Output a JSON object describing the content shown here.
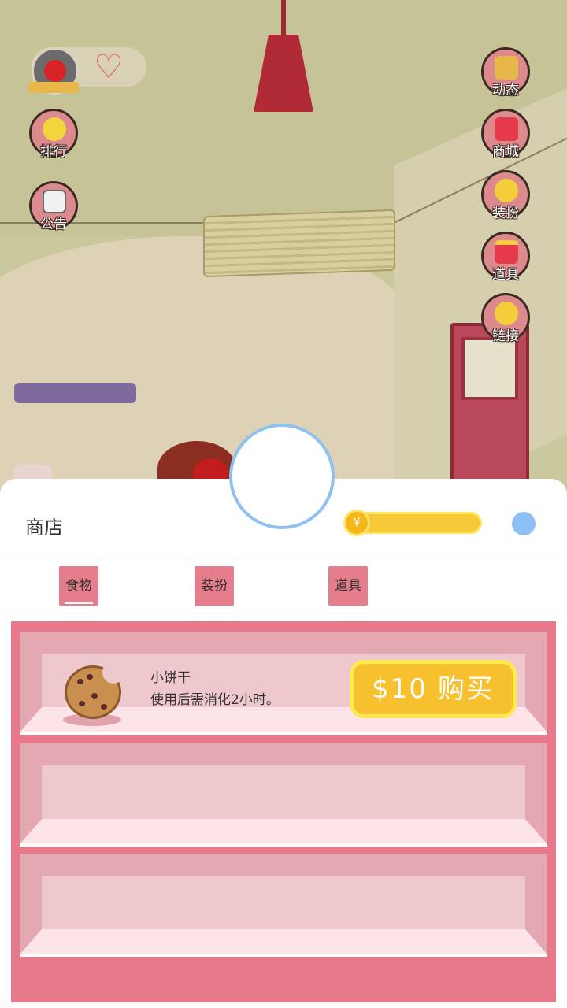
{
  "hud": {
    "avatar_icon": "angry-bird-avatar",
    "heart_icon": "heart-outline-icon",
    "left_buttons": [
      {
        "label": "排行",
        "icon": "chick-crown-icon"
      },
      {
        "label": "公告",
        "icon": "clipboard-icon"
      }
    ],
    "right_buttons": [
      {
        "label": "动态",
        "icon": "window-icon"
      },
      {
        "label": "商城",
        "icon": "shopping-bag-icon"
      },
      {
        "label": "装扮",
        "icon": "clover-icon"
      },
      {
        "label": "道具",
        "icon": "gift-box-icon"
      },
      {
        "label": "链接",
        "icon": "chick-link-icon"
      }
    ]
  },
  "shop": {
    "title": "商店",
    "coin_symbol": "¥",
    "tabs": [
      {
        "label": "食物",
        "selected": true
      },
      {
        "label": "装扮",
        "selected": false
      },
      {
        "label": "道具",
        "selected": false
      }
    ],
    "items": [
      {
        "name": "小饼干",
        "description": "使用后需消化2小时。",
        "icon": "cookie-icon",
        "buy_label": "$10 购买"
      }
    ]
  },
  "colors": {
    "accent_pink": "#e8798b",
    "buy_yellow": "#f7c02e",
    "circle_blue": "#8ec0f0"
  }
}
